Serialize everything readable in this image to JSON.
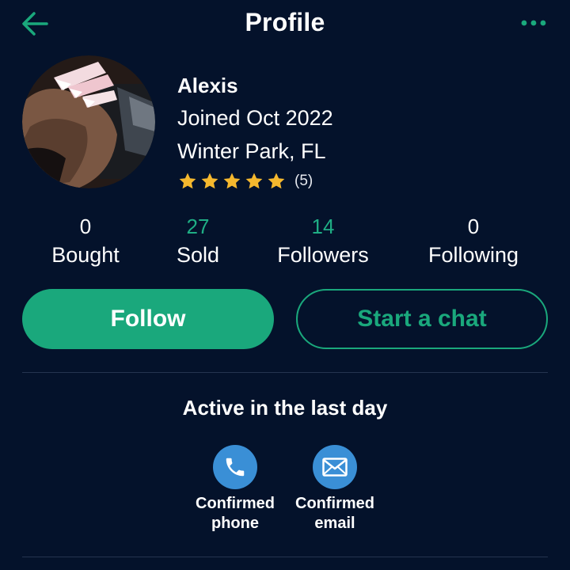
{
  "header": {
    "title": "Profile",
    "back_icon": "arrow-left-icon",
    "more_icon": "more-horizontal-icon"
  },
  "profile": {
    "name": "Alexis",
    "joined": "Joined Oct 2022",
    "location": "Winter Park, FL",
    "rating": 5,
    "rating_count": "(5)"
  },
  "stats": [
    {
      "value": "0",
      "label": "Bought"
    },
    {
      "value": "27",
      "label": "Sold"
    },
    {
      "value": "14",
      "label": "Followers"
    },
    {
      "value": "0",
      "label": "Following"
    }
  ],
  "actions": {
    "follow_label": "Follow",
    "chat_label": "Start a chat"
  },
  "activity": {
    "text": "Active in the last day"
  },
  "verifications": [
    {
      "icon": "phone-icon",
      "line1": "Confirmed",
      "line2": "phone"
    },
    {
      "icon": "envelope-icon",
      "line1": "Confirmed",
      "line2": "email"
    }
  ],
  "colors": {
    "background": "#04122b",
    "accent": "#1aa87c",
    "star": "#f5b82e",
    "verify_badge": "#3a8fd6"
  }
}
